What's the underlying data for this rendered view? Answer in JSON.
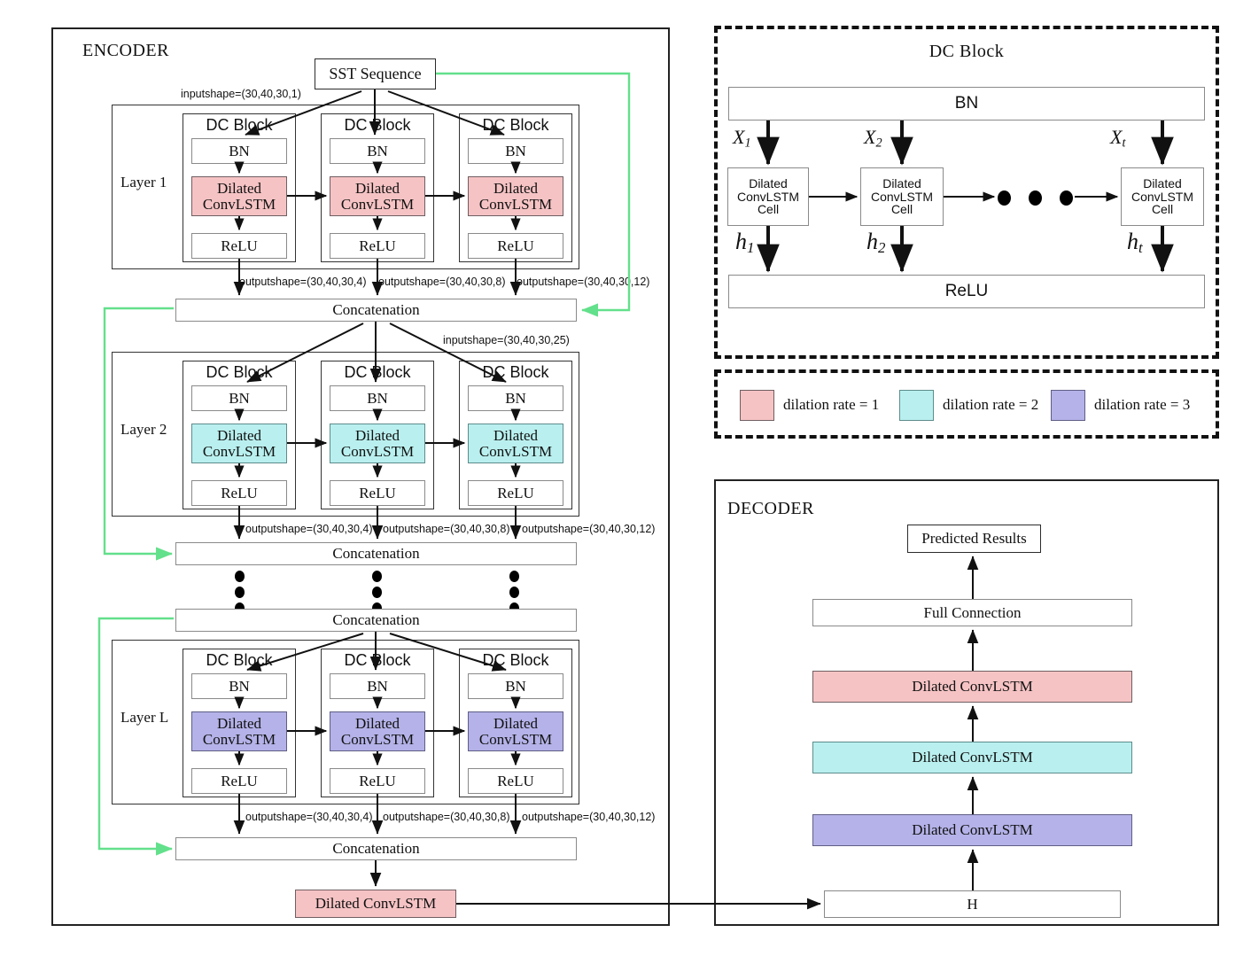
{
  "colors": {
    "dilation1": "#f6c3c4",
    "dilation2": "#b9f0ef",
    "dilation3": "#b4b2e8",
    "skip_connection": "#63e08b",
    "outline": "#333333"
  },
  "encoder": {
    "title": "ENCODER",
    "input_box": "SST Sequence",
    "input_shape_note": "inputshape=(30,40,30,1)",
    "concat_input_shape_note": "inputshape=(30,40,30,25)",
    "output_shape_notes": [
      "outputshape=(30,40,30,4)",
      "outputshape=(30,40,30,8)",
      "outputshape=(30,40,30,12)"
    ],
    "concat_label": "Concatenation",
    "final_conv": "Dilated ConvLSTM",
    "layers": [
      {
        "name": "Layer  1",
        "dilation_rate": 1,
        "color": "#f6c3c4",
        "blocks": [
          {
            "title": "DC Block",
            "bn": "BN",
            "conv": "Dilated ConvLSTM",
            "relu": "ReLU"
          },
          {
            "title": "DC Block",
            "bn": "BN",
            "conv": "Dilated ConvLSTM",
            "relu": "ReLU"
          },
          {
            "title": "DC Block",
            "bn": "BN",
            "conv": "Dilated ConvLSTM",
            "relu": "ReLU"
          }
        ]
      },
      {
        "name": "Layer  2",
        "dilation_rate": 2,
        "color": "#b9f0ef",
        "blocks": [
          {
            "title": "DC Block",
            "bn": "BN",
            "conv": "Dilated ConvLSTM",
            "relu": "ReLU"
          },
          {
            "title": "DC Block",
            "bn": "BN",
            "conv": "Dilated ConvLSTM",
            "relu": "ReLU"
          },
          {
            "title": "DC Block",
            "bn": "BN",
            "conv": "Dilated ConvLSTM",
            "relu": "ReLU"
          }
        ]
      },
      {
        "name": "Layer L",
        "dilation_rate": 3,
        "color": "#b4b2e8",
        "blocks": [
          {
            "title": "DC Block",
            "bn": "BN",
            "conv": "Dilated ConvLSTM",
            "relu": "ReLU"
          },
          {
            "title": "DC Block",
            "bn": "BN",
            "conv": "Dilated ConvLSTM",
            "relu": "ReLU"
          },
          {
            "title": "DC Block",
            "bn": "BN",
            "conv": "Dilated ConvLSTM",
            "relu": "ReLU"
          }
        ]
      }
    ]
  },
  "dc_block_panel": {
    "title": "DC Block",
    "bn": "BN",
    "relu": "ReLU",
    "cells": [
      {
        "line1": "Dilated",
        "line2": "ConvLSTM",
        "line3": "Cell",
        "input": "X",
        "input_sub": "1",
        "output": "h",
        "output_sub": "1"
      },
      {
        "line1": "Dilated",
        "line2": "ConvLSTM",
        "line3": "Cell",
        "input": "X",
        "input_sub": "2",
        "output": "h",
        "output_sub": "2"
      },
      {
        "line1": "Dilated",
        "line2": "ConvLSTM",
        "line3": "Cell",
        "input": "X",
        "input_sub": "t",
        "output": "h",
        "output_sub": "t"
      }
    ],
    "ellipsis_dots": 3
  },
  "legend": {
    "items": [
      {
        "label": "dilation rate = 1",
        "color": "#f6c3c4"
      },
      {
        "label": "dilation rate = 2",
        "color": "#b9f0ef"
      },
      {
        "label": "dilation rate = 3",
        "color": "#b4b2e8"
      }
    ]
  },
  "decoder": {
    "title": "DECODER",
    "predicted": "Predicted Results",
    "full_connection": "Full Connection",
    "conv_layers": [
      {
        "label": "Dilated ConvLSTM",
        "color": "#f6c3c4"
      },
      {
        "label": "Dilated ConvLSTM",
        "color": "#b9f0ef"
      },
      {
        "label": "Dilated ConvLSTM",
        "color": "#b4b2e8"
      }
    ],
    "h_box": "H"
  }
}
